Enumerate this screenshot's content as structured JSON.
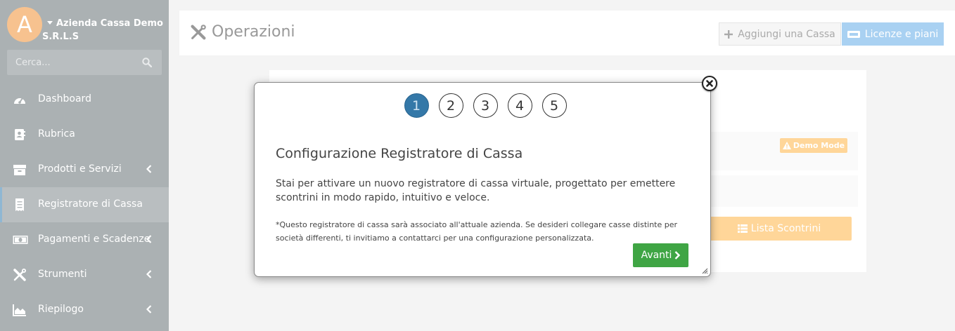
{
  "sidebar": {
    "avatar_letter": "A",
    "company": "Azienda Cassa Demo S.R.L.S",
    "search_placeholder": "Cerca...",
    "items": [
      {
        "label": "Dashboard",
        "icon": "gauge-icon",
        "has_submenu": false
      },
      {
        "label": "Rubrica",
        "icon": "address-book-icon",
        "has_submenu": false
      },
      {
        "label": "Prodotti e Servizi",
        "icon": "box-icon",
        "has_submenu": true
      },
      {
        "label": "Registratore di Cassa",
        "icon": "receipt-icon",
        "has_submenu": false,
        "active": true
      },
      {
        "label": "Pagamenti e Scadenze",
        "icon": "money-icon",
        "has_submenu": true
      },
      {
        "label": "Strumenti",
        "icon": "tools-icon",
        "has_submenu": true
      },
      {
        "label": "Riepilogo",
        "icon": "area-chart-icon",
        "has_submenu": true
      }
    ]
  },
  "header": {
    "title": "Operazioni",
    "add_button": "Aggiungi una Cassa",
    "license_button": "Licenze e piani"
  },
  "background": {
    "demo_badge": "Demo Mode",
    "lista_button": "Lista Scontrini"
  },
  "modal": {
    "steps": [
      "1",
      "2",
      "3",
      "4",
      "5"
    ],
    "active_step": 1,
    "title": "Configurazione Registratore di Cassa",
    "text": "Stai per attivare un nuovo registratore di cassa virtuale, progettato per emettere scontrini in modo rapido, intuitivo e veloce.",
    "note": "*Questo registratore di cassa sarà associato all'attuale azienda. Se desideri collegare casse distinte per società differenti, ti invitiamo a contattarci per una configurazione personalizzata.",
    "next_button": "Avanti"
  },
  "colors": {
    "sidebar_bg": "#abb1b3",
    "avatar": "#f7c28f",
    "step_active": "#3478a8",
    "next_button": "#3fa544",
    "warning": "#ffd699",
    "license_button": "#a9d1f2"
  }
}
